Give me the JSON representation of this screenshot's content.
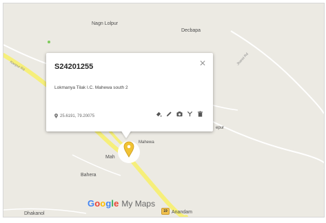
{
  "map": {
    "places": {
      "nagn_lolpur": "Nagn Lolpur",
      "decbapa": "Decbapa",
      "bahera": "Bahera",
      "mah": "Mah",
      "dhakanol": "Dhakanol",
      "anandam": "Anandam",
      "mahewa": "Mahewa",
      "epur": "epur"
    },
    "road_labels": {
      "left": "Kanpur Rd",
      "right": "Jhansi Rd"
    },
    "highway_shield": "19",
    "colors": {
      "land": "#eceae3",
      "highway": "#f6ef7a",
      "pin": "#f1c232"
    }
  },
  "popup": {
    "title": "S24201255",
    "address": "Lokmanya Tilak I.C. Mahewa south 2",
    "coordinates": "25.6191, 79.20075",
    "close_icon": "close-icon",
    "actions": [
      "style-icon",
      "edit-icon",
      "camera-icon",
      "directions-icon",
      "delete-icon"
    ]
  },
  "branding": {
    "google": "Google",
    "product": "My Maps"
  }
}
